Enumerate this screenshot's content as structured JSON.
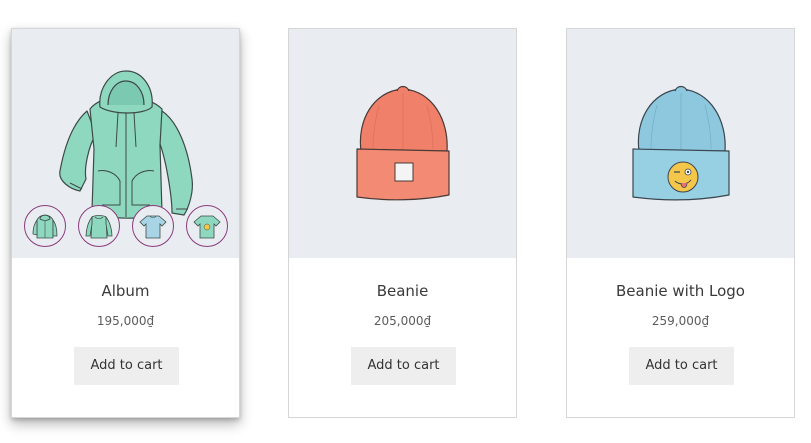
{
  "products": [
    {
      "name": "Album",
      "price": "195,000₫",
      "button_label": "Add to cart",
      "image_icon": "hoodie-icon",
      "gallery_icons": [
        "hoodie-icon",
        "longsleeve-icon",
        "tshirt-icon",
        "tshirt-logo-icon"
      ]
    },
    {
      "name": "Beanie",
      "price": "205,000₫",
      "button_label": "Add to cart",
      "image_icon": "beanie-icon"
    },
    {
      "name": "Beanie with Logo",
      "price": "259,000₫",
      "button_label": "Add to cart",
      "image_icon": "beanie-logo-icon"
    }
  ],
  "colors": {
    "image_bg": "#e9edf1",
    "button_bg": "#eeeeee",
    "thumb_border": "#8a3c7c",
    "hoodie": "#8fd8c0",
    "beanie_orange": "#f0806a",
    "beanie_blue": "#8ec8de"
  }
}
